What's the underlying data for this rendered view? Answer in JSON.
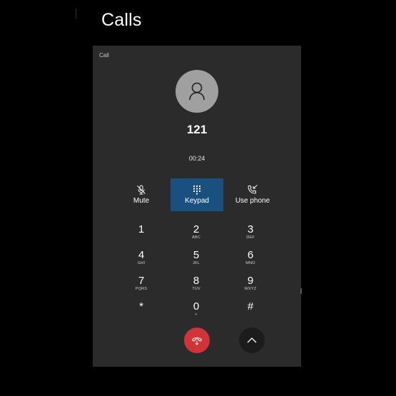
{
  "app": {
    "title": "Calls"
  },
  "panel": {
    "caption": "Call"
  },
  "call": {
    "number": "121",
    "duration": "00:24"
  },
  "actions": [
    {
      "label": "Mute",
      "icon": "mic-off-icon",
      "active": false
    },
    {
      "label": "Keypad",
      "icon": "dialpad-icon",
      "active": true
    },
    {
      "label": "Use phone",
      "icon": "phone-transfer-icon",
      "active": false
    }
  ],
  "keypad": [
    {
      "digit": "1",
      "letters": ""
    },
    {
      "digit": "2",
      "letters": "ABC"
    },
    {
      "digit": "3",
      "letters": "DEF"
    },
    {
      "digit": "4",
      "letters": "GHI"
    },
    {
      "digit": "5",
      "letters": "JKL"
    },
    {
      "digit": "6",
      "letters": "MNO"
    },
    {
      "digit": "7",
      "letters": "PQRS"
    },
    {
      "digit": "8",
      "letters": "TUV"
    },
    {
      "digit": "9",
      "letters": "WXYZ"
    },
    {
      "digit": "*",
      "letters": ""
    },
    {
      "digit": "0",
      "letters": "+"
    },
    {
      "digit": "#",
      "letters": ""
    }
  ],
  "colors": {
    "accent": "#1a5080",
    "end_call": "#d13438",
    "panel": "#2b2b2b"
  }
}
